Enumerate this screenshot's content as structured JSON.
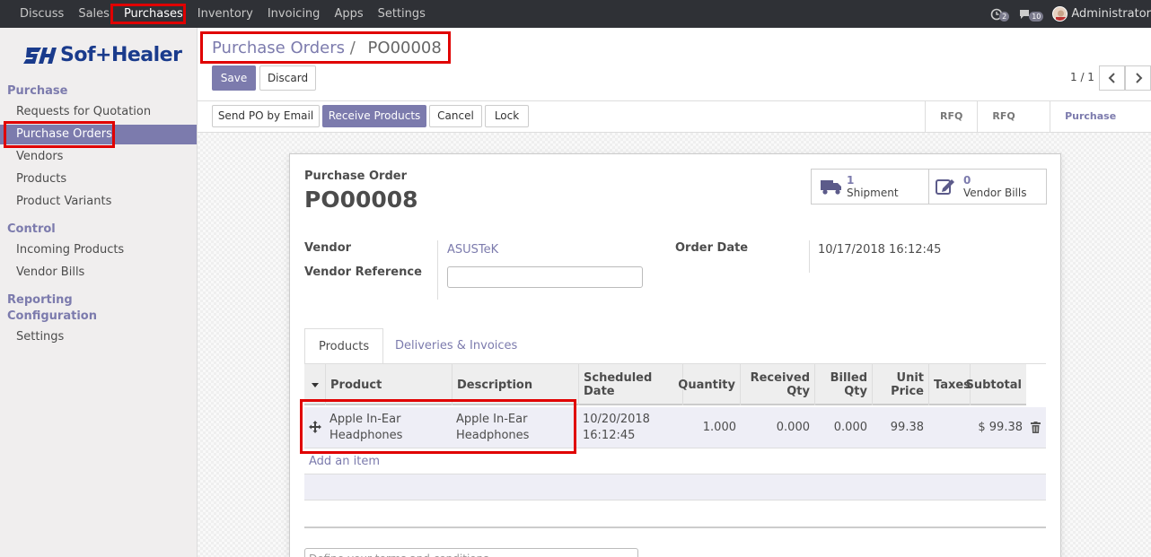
{
  "topbar": {
    "menu": [
      "Discuss",
      "Sales",
      "Purchases",
      "Inventory",
      "Invoicing",
      "Apps",
      "Settings"
    ],
    "active_menu": "Purchases",
    "activity_count": "2",
    "message_count": "10",
    "user": "Administrator"
  },
  "sidebar": {
    "logo_text": "Sof+Healer",
    "sections": {
      "purchase": "Purchase",
      "control": "Control",
      "reporting": "Reporting",
      "configuration": "Configuration"
    },
    "items": {
      "rfq": "Requests for Quotation",
      "purchase_orders": "Purchase Orders",
      "vendors": "Vendors",
      "products": "Products",
      "product_variants": "Product Variants",
      "incoming_products": "Incoming Products",
      "vendor_bills": "Vendor Bills",
      "settings": "Settings"
    }
  },
  "breadcrumb": {
    "parent": "Purchase Orders",
    "separator": "/",
    "current": "PO00008"
  },
  "control": {
    "save": "Save",
    "discard": "Discard",
    "pager": "1 / 1"
  },
  "actions": {
    "send_po": "Send PO by Email",
    "receive": "Receive Products",
    "cancel": "Cancel",
    "lock": "Lock"
  },
  "statusbar": [
    "RFQ",
    "RFQ Sent",
    "Purchase Order"
  ],
  "form": {
    "title_label": "Purchase Order",
    "name": "PO00008",
    "smart_buttons": {
      "shipment_count": "1",
      "shipment_label": "Shipment",
      "bills_count": "0",
      "bills_label": "Vendor Bills"
    },
    "vendor_label": "Vendor",
    "vendor_value": "ASUSTeK",
    "vendor_ref_label": "Vendor Reference",
    "vendor_ref_value": "",
    "order_date_label": "Order Date",
    "order_date_value": "10/17/2018 16:12:45"
  },
  "tabs": {
    "products": "Products",
    "deliveries": "Deliveries & Invoices"
  },
  "table": {
    "headers": {
      "product": "Product",
      "description": "Description",
      "scheduled_date": "Scheduled Date",
      "quantity": "Quantity",
      "received_1": "Received",
      "received_2": "Qty",
      "billed_1": "Billed",
      "billed_2": "Qty",
      "unit_1": "Unit",
      "unit_2": "Price",
      "taxes": "Taxes",
      "subtotal": "Subtotal"
    },
    "row": {
      "product_1": "Apple In-Ear",
      "product_2": "Headphones",
      "description_1": "Apple In-Ear",
      "description_2": "Headphones",
      "date_1": "10/20/2018",
      "date_2": "16:12:45",
      "quantity": "1.000",
      "received": "0.000",
      "billed": "0.000",
      "unit_price": "99.38",
      "taxes": "",
      "subtotal": "$ 99.38"
    },
    "add_item": "Add an item"
  },
  "notes_placeholder": "Define your terms and conditions ...",
  "colors": {
    "accent": "#7c7bad",
    "highlight": "#e00000",
    "topbar": "#2f3136"
  }
}
